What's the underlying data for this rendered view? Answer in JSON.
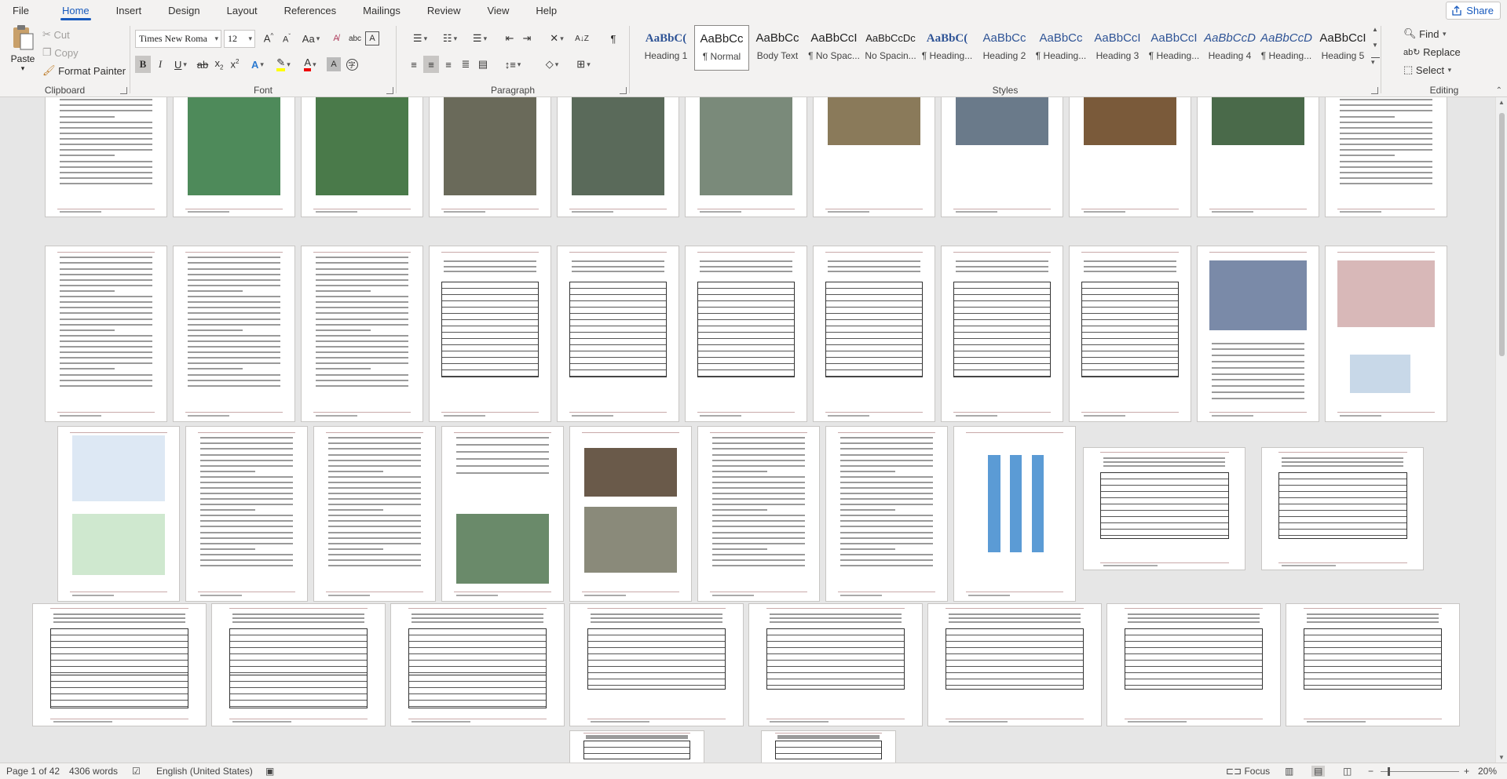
{
  "menu": {
    "tabs": [
      "File",
      "Home",
      "Insert",
      "Design",
      "Layout",
      "References",
      "Mailings",
      "Review",
      "View",
      "Help"
    ],
    "share": "Share"
  },
  "ribbon": {
    "clipboard": {
      "paste": "Paste",
      "cut": "Cut",
      "copy": "Copy",
      "format_painter": "Format Painter",
      "label": "Clipboard"
    },
    "font": {
      "name": "Times New Roma",
      "size": "12",
      "label": "Font"
    },
    "paragraph": {
      "label": "Paragraph"
    },
    "styles": {
      "label": "Styles",
      "items": [
        {
          "preview": "AaBbC(",
          "name": "Heading 1"
        },
        {
          "preview": "AaBbCc",
          "name": "¶ Normal"
        },
        {
          "preview": "AaBbCc",
          "name": "Body Text"
        },
        {
          "preview": "AaBbCcI",
          "name": "¶ No Spac..."
        },
        {
          "preview": "AaBbCcDc",
          "name": "No Spacin..."
        },
        {
          "preview": "AaBbC(",
          "name": "¶ Heading..."
        },
        {
          "preview": "AaBbCc",
          "name": "Heading 2"
        },
        {
          "preview": "AaBbCc",
          "name": "¶ Heading..."
        },
        {
          "preview": "AaBbCcI",
          "name": "Heading 3"
        },
        {
          "preview": "AaBbCcI",
          "name": "¶ Heading..."
        },
        {
          "preview": "AaBbCcD",
          "name": "Heading 4"
        },
        {
          "preview": "AaBbCcD",
          "name": "¶ Heading..."
        },
        {
          "preview": "AaBbCcI",
          "name": "Heading 5"
        }
      ]
    },
    "editing": {
      "find": "Find",
      "replace": "Replace",
      "select": "Select",
      "label": "Editing"
    }
  },
  "status": {
    "page": "Page 1 of 42",
    "words": "4306 words",
    "language": "English (United States)",
    "focus": "Focus",
    "zoom": "20%"
  },
  "colors": {
    "accent": "#185abd",
    "ribbon_bg": "#f3f2f1",
    "canvas_bg": "#e6e6e6"
  }
}
